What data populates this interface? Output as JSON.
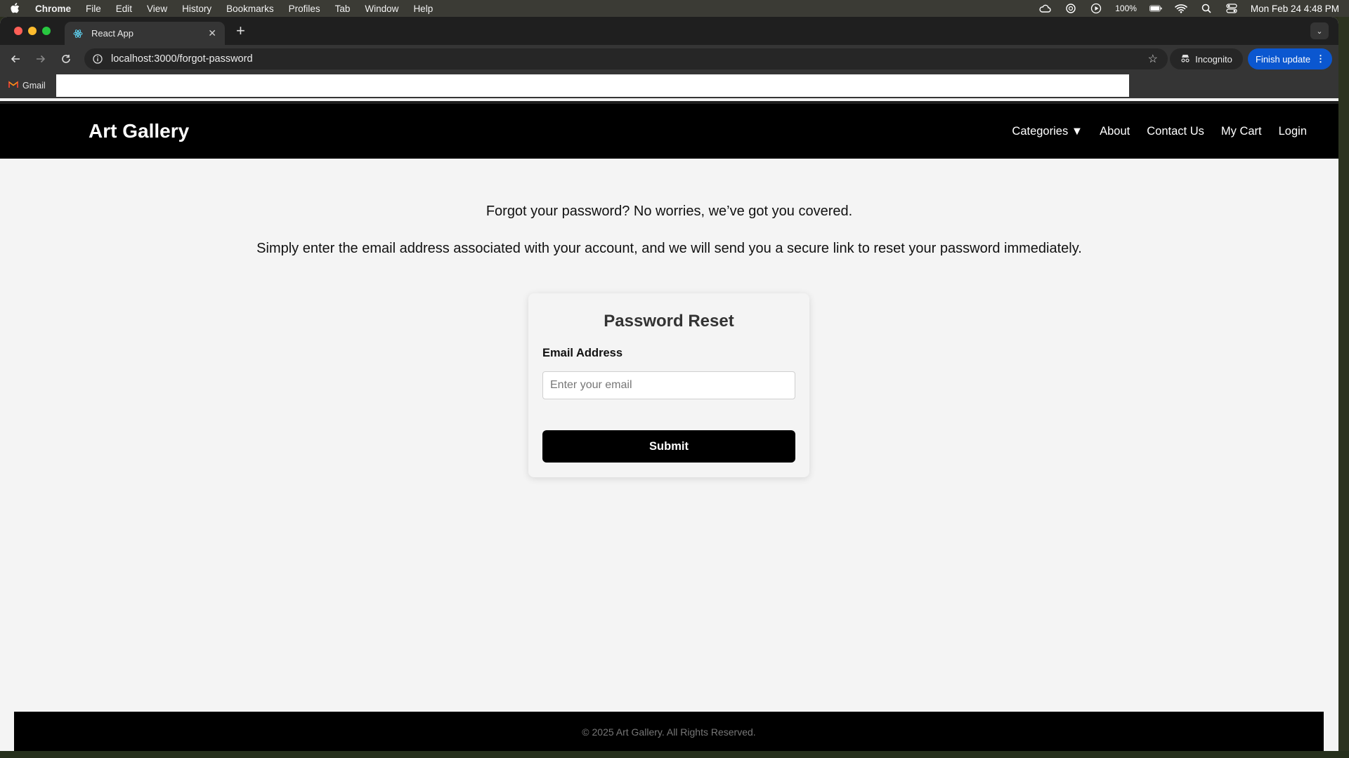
{
  "menubar": {
    "app_name": "Chrome",
    "items": [
      "File",
      "Edit",
      "View",
      "History",
      "Bookmarks",
      "Profiles",
      "Tab",
      "Window",
      "Help"
    ],
    "battery": "100%",
    "clock": "Mon Feb 24  4:48 PM"
  },
  "browser": {
    "tab_title": "React App",
    "url": "localhost:3000/forgot-password",
    "incognito_label": "Incognito",
    "finish_update_label": "Finish update",
    "bookmark_gmail": "Gmail"
  },
  "site": {
    "brand": "Art Gallery",
    "nav": {
      "categories": "Categories ▼",
      "about": "About",
      "contact": "Contact Us",
      "cart": "My Cart",
      "login": "Login"
    },
    "lead1": "Forgot your password? No worries, we’ve got you covered.",
    "lead2": "Simply enter the email address associated with your account, and we will send you a secure link to reset your password immediately.",
    "card": {
      "title": "Password Reset",
      "email_label": "Email Address",
      "email_placeholder": "Enter your email",
      "email_value": "",
      "submit_label": "Submit"
    },
    "footer": "© 2025 Art Gallery. All Rights Reserved."
  },
  "colors": {
    "nav_bg": "#000000",
    "page_bg": "#f4f4f4",
    "button_bg": "#000000",
    "finish_update_bg": "#0b57d0"
  }
}
